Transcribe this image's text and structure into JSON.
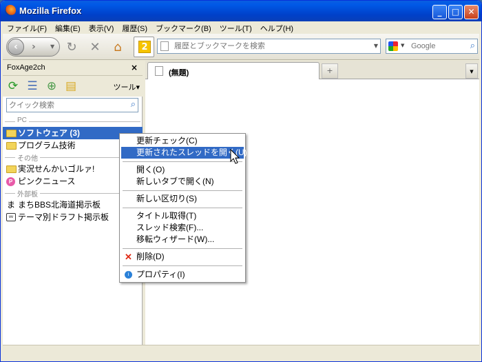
{
  "window": {
    "title": "Mozilla Firefox"
  },
  "menubar": [
    "ファイル(F)",
    "編集(E)",
    "表示(V)",
    "履歴(S)",
    "ブックマーク(B)",
    "ツール(T)",
    "ヘルプ(H)"
  ],
  "nav": {
    "badge": "2",
    "url_placeholder": "履歴とブックマークを検索",
    "search_placeholder": "Google"
  },
  "sidebar": {
    "title": "FoxAge2ch",
    "tools_label": "ツール▾",
    "quick_placeholder": "クイック検索",
    "tree": {
      "sep_pc": "PC",
      "software": "ソフトウェア (3)",
      "programming": "プログラム技術",
      "sep_other": "その他",
      "live": "実況せんかいゴルァ!",
      "pink": "ピンクニュース",
      "sep_external": "外部板",
      "machi": "まちBBS北海道掲示板",
      "theme": "テーマ別ドラフト掲示板"
    }
  },
  "tabs": {
    "current": "(無題)"
  },
  "context_menu": {
    "check_updates": "更新チェック(C)",
    "open_updated": "更新されたスレッドを開く(U)",
    "open": "開く(O)",
    "open_new_tab": "新しいタブで開く(N)",
    "new_separator": "新しい区切り(S)",
    "get_title": "タイトル取得(T)",
    "thread_search": "スレッド検索(F)...",
    "move_wizard": "移転ウィザード(W)...",
    "delete": "削除(D)",
    "properties": "プロパティ(I)"
  }
}
